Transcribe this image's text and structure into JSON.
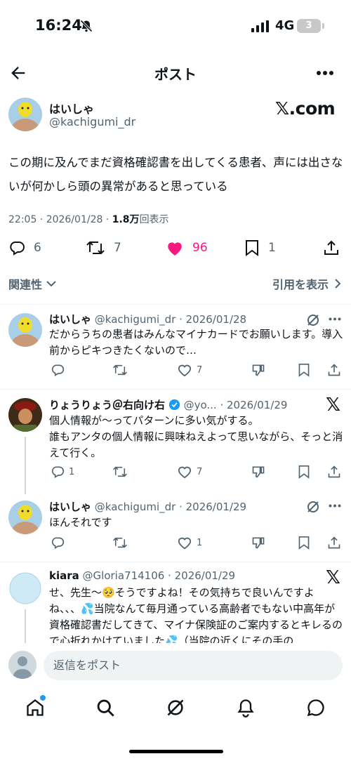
{
  "status_bar": {
    "time": "16:24",
    "network": "4G",
    "battery": "3"
  },
  "nav": {
    "title": "ポスト"
  },
  "main_post": {
    "display_name": "はいしゃ",
    "handle": "@kachigumi_dr",
    "watermark": "𝕏.com",
    "text": "この期に及んでまだ資格確認書を出してくる患者、声には出さないが何かしら頭の異常があると思っている",
    "time_date": "22:05 · 2026/01/28 · ",
    "views_count": "1.8万",
    "views_label": "回表示",
    "replies": "6",
    "reposts": "7",
    "likes": "96",
    "bookmarks": "1",
    "liked_color": "#f91880"
  },
  "sort": {
    "label": "関連性",
    "quotes_label": "引用を表示"
  },
  "replies": [
    {
      "display_name": "はいしゃ",
      "handle": "@kachigumi_dr · 2026/01/28",
      "text": "だからうちの患者はみんなマイナカードでお願いします。導入前からピキつきたくないので…",
      "replies": "",
      "reposts": "",
      "likes": "7"
    },
    {
      "display_name": "りょうりょう＠右向け右",
      "handle": "@yo... · 2026/01/29",
      "text": "個人情報が〜ってパターンに多い気がする。\n誰もアンタの個人情報に興味ねえよって思いながら、そっと消えて行く。",
      "replies": "1",
      "reposts": "",
      "likes": "7",
      "verified_color": "#1d9bf0"
    },
    {
      "display_name": "はいしゃ",
      "handle": "@kachigumi_dr · 2026/01/29",
      "text": "ほんそれです",
      "replies": "",
      "reposts": "",
      "likes": "1"
    },
    {
      "display_name": "kiara",
      "handle": "@Gloria714106 · 2026/01/29",
      "text": "せ、先生〜🥺そうですよね！その気持ちで良いんですよね、、、💦当院なんて毎月通っている高齢者でもない中高年が資格確認書だしてきて、マイナ保険証のご案内するとキレるので心折れかけていました💦（当院の近くにその手の"
    }
  ],
  "compose": {
    "placeholder": "返信をポスト"
  },
  "tabs": [
    "home",
    "search",
    "grok",
    "notifications",
    "messages"
  ]
}
